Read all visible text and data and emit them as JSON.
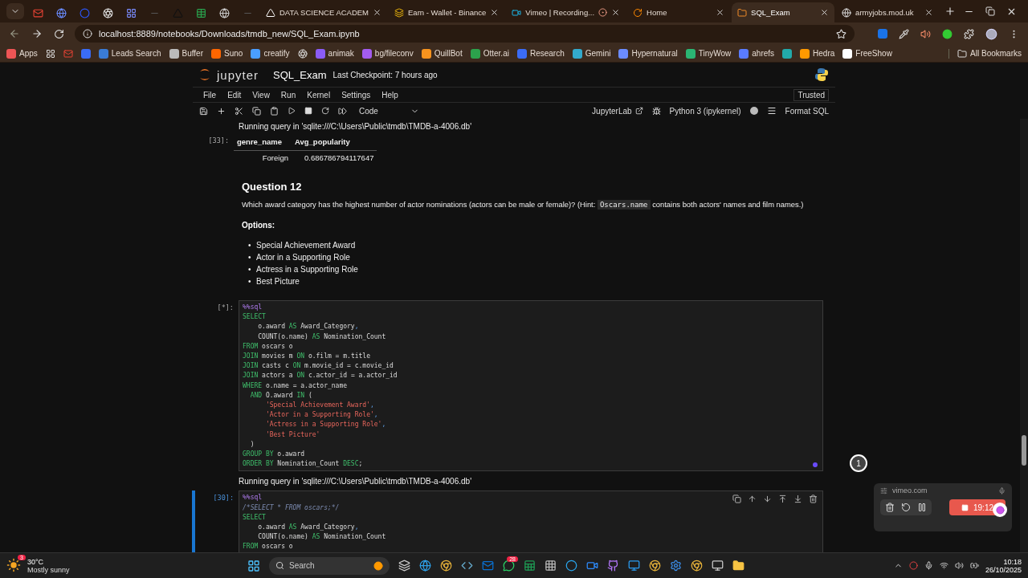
{
  "browser": {
    "tabs": [
      {
        "title": "DATA SCIENCE ACADEM",
        "selected": false
      },
      {
        "title": "Earn - Wallet - Binance",
        "selected": false
      },
      {
        "title": "Vimeo | Recording...",
        "selected": false
      },
      {
        "title": "Home",
        "selected": false
      },
      {
        "title": "SQL_Exam",
        "selected": true
      },
      {
        "title": "armyjobs.mod.uk",
        "selected": false
      }
    ],
    "address": "localhost:8889/notebooks/Downloads/tmdb_new/SQL_Exam.ipynb",
    "bookmarks": [
      "Apps",
      "Leads Search",
      "Buffer",
      "Suno",
      "creatify",
      "animak",
      "bg/fileconv",
      "QuillBot",
      "Otter.ai",
      "Research",
      "Gemini",
      "Hypernatural",
      "TinyWow",
      "ahrefs",
      "Hedra",
      "FreeShow"
    ],
    "all_bookmarks": "All Bookmarks"
  },
  "notebook": {
    "logo": "jupyter",
    "title": "SQL_Exam",
    "checkpoint": "Last Checkpoint: 7 hours ago",
    "menu": [
      "File",
      "Edit",
      "View",
      "Run",
      "Kernel",
      "Settings",
      "Help"
    ],
    "trusted": "Trusted",
    "cell_type": "Code",
    "jupyterlab": "JupyterLab",
    "kernel": "Python 3 (ipykernel)",
    "format": "Format SQL"
  },
  "cells": [
    {
      "kind": "table_output",
      "prompt": "[33]:",
      "message": "Running query in 'sqlite:///C:\\Users\\Public\\tmdb\\TMDB-a-4006.db'",
      "columns": [
        "genre_name",
        "Avg_popularity"
      ],
      "rows": [
        [
          "Foreign",
          "0.686786794117647"
        ]
      ]
    },
    {
      "kind": "markdown",
      "heading": "Question 12",
      "question": [
        {
          "kind": "text",
          "text": "Which award category has the highest number of actor nominations (actors can be male or female)? (Hint: "
        },
        {
          "kind": "code",
          "text": "Oscars.name"
        },
        {
          "kind": "text",
          "text": " contains both actors' names and film names.)"
        }
      ],
      "options_label": "Options:",
      "marker": "•",
      "options": [
        "Special Achievement Award",
        "Actor in a Supporting Role",
        "Actress in a Supporting Role",
        "Best Picture"
      ]
    },
    {
      "kind": "code",
      "prompt": "[*]:",
      "selected": false,
      "running": true,
      "lines": [
        [
          {
            "kind": "magic",
            "text": "%%sql"
          }
        ],
        [
          {
            "kind": "keyword",
            "text": "SELECT"
          }
        ],
        [
          {
            "kind": "plain",
            "text": "    o.award "
          },
          {
            "kind": "keyword",
            "text": "AS"
          },
          {
            "kind": "plain",
            "text": " Award_Category"
          },
          {
            "kind": "op",
            "text": ","
          }
        ],
        [
          {
            "kind": "plain",
            "text": "    COUNT(o.name) "
          },
          {
            "kind": "keyword",
            "text": "AS"
          },
          {
            "kind": "plain",
            "text": " Nomination_Count"
          }
        ],
        [
          {
            "kind": "keyword",
            "text": "FROM"
          },
          {
            "kind": "plain",
            "text": " oscars o"
          }
        ],
        [
          {
            "kind": "keyword",
            "text": "JOIN"
          },
          {
            "kind": "plain",
            "text": " movies m "
          },
          {
            "kind": "keyword",
            "text": "ON"
          },
          {
            "kind": "plain",
            "text": " o.film = m.title"
          }
        ],
        [
          {
            "kind": "keyword",
            "text": "JOIN"
          },
          {
            "kind": "plain",
            "text": " casts c "
          },
          {
            "kind": "keyword",
            "text": "ON"
          },
          {
            "kind": "plain",
            "text": " m.movie_id = c.movie_id"
          }
        ],
        [
          {
            "kind": "keyword",
            "text": "JOIN"
          },
          {
            "kind": "plain",
            "text": " actors a "
          },
          {
            "kind": "keyword",
            "text": "ON"
          },
          {
            "kind": "plain",
            "text": " c.actor_id = a.actor_id"
          }
        ],
        [
          {
            "kind": "keyword",
            "text": "WHERE"
          },
          {
            "kind": "plain",
            "text": " o.name = a.actor_name"
          }
        ],
        [
          {
            "kind": "keyword",
            "text": "  AND"
          },
          {
            "kind": "plain",
            "text": " O.award "
          },
          {
            "kind": "keyword",
            "text": "IN"
          },
          {
            "kind": "plain",
            "text": " ("
          }
        ],
        [
          {
            "kind": "string",
            "text": "      'Special Achievement Award'"
          },
          {
            "kind": "op",
            "text": ","
          }
        ],
        [
          {
            "kind": "string",
            "text": "      'Actor in a Supporting Role'"
          },
          {
            "kind": "op",
            "text": ","
          }
        ],
        [
          {
            "kind": "string",
            "text": "      'Actress in a Supporting Role'"
          },
          {
            "kind": "op",
            "text": ","
          }
        ],
        [
          {
            "kind": "string",
            "text": "      'Best Picture'"
          }
        ],
        [
          {
            "kind": "plain",
            "text": "  )"
          }
        ],
        [
          {
            "kind": "keyword",
            "text": "GROUP BY"
          },
          {
            "kind": "plain",
            "text": " o.award"
          }
        ],
        [
          {
            "kind": "keyword",
            "text": "ORDER BY"
          },
          {
            "kind": "plain",
            "text": " Nomination_Count "
          },
          {
            "kind": "keyword",
            "text": "DESC"
          },
          {
            "kind": "plain",
            "text": ";"
          }
        ]
      ]
    },
    {
      "kind": "stream",
      "text": "Running query in 'sqlite:///C:\\Users\\Public\\tmdb\\TMDB-a-4006.db'"
    },
    {
      "kind": "code",
      "prompt": "[30]:",
      "selected": true,
      "running": false,
      "lines": [
        [
          {
            "kind": "magic",
            "text": "%%sql"
          }
        ],
        [
          {
            "kind": "comment",
            "text": "/*SELECT * FROM oscars;*/"
          }
        ],
        [
          {
            "kind": "keyword",
            "text": "SELECT"
          }
        ],
        [
          {
            "kind": "plain",
            "text": "    o.award "
          },
          {
            "kind": "keyword",
            "text": "AS"
          },
          {
            "kind": "plain",
            "text": " Award_Category"
          },
          {
            "kind": "op",
            "text": ","
          }
        ],
        [
          {
            "kind": "plain",
            "text": "    COUNT(o.name) "
          },
          {
            "kind": "keyword",
            "text": "AS"
          },
          {
            "kind": "plain",
            "text": " Nomination_Count"
          }
        ],
        [
          {
            "kind": "keyword",
            "text": "FROM"
          },
          {
            "kind": "plain",
            "text": " oscars o"
          }
        ]
      ]
    }
  ],
  "overlay": {
    "notification_count": "1",
    "site": "vimeo.com",
    "timer": "19:12"
  },
  "taskbar": {
    "temperature": "30°C",
    "weather": "Mostly sunny",
    "weather_badge": "3",
    "search": "Search",
    "chat_badge": "28",
    "time": "10:18",
    "date": "26/10/2025"
  }
}
